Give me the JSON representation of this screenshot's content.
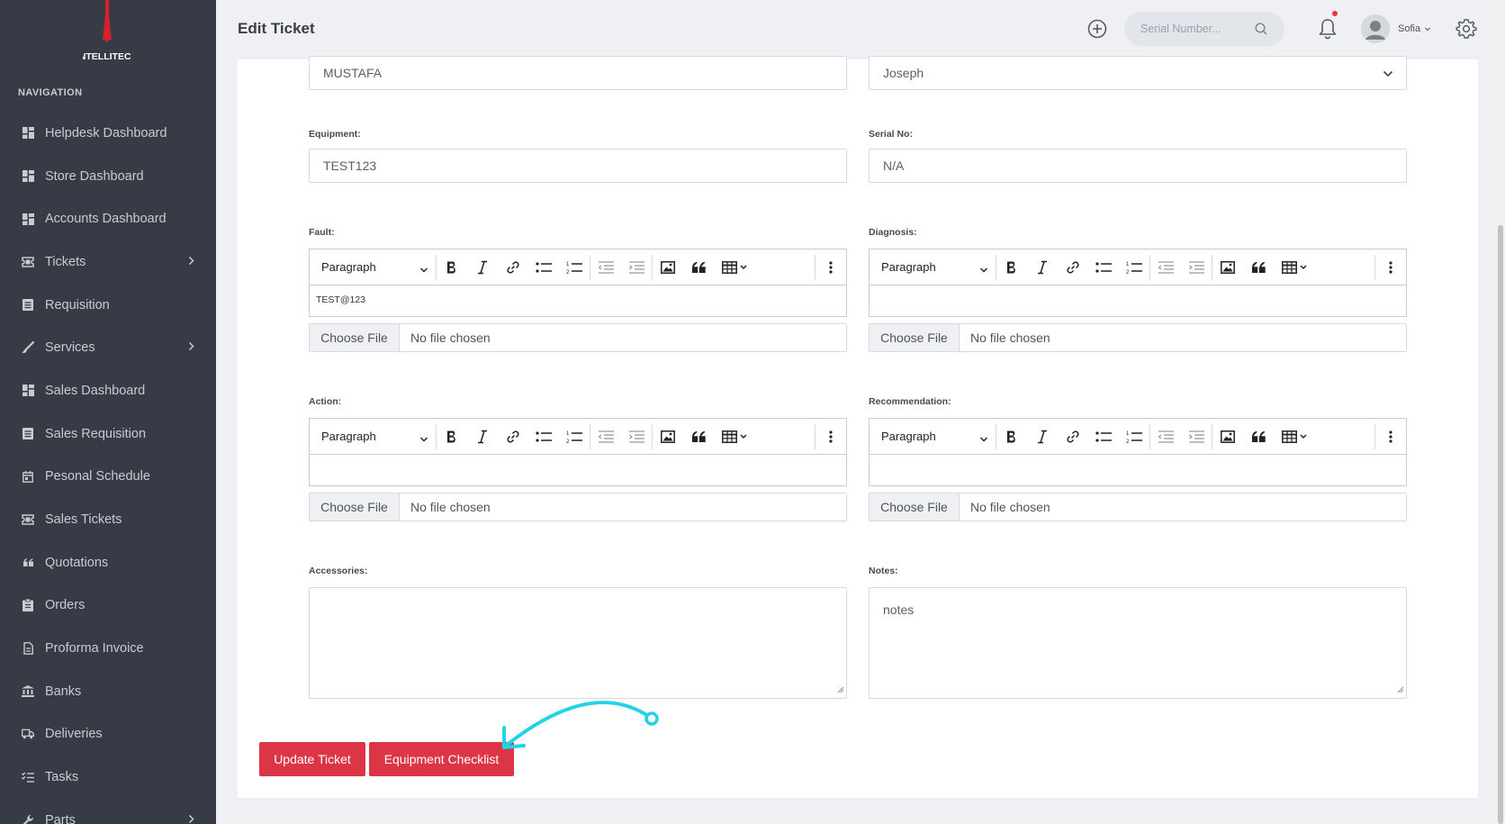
{
  "sidebar": {
    "logo_text": "INTELLITECH",
    "heading": "NAVIGATION",
    "items": [
      {
        "label": "Helpdesk Dashboard",
        "icon": "dashboard-icon"
      },
      {
        "label": "Store Dashboard",
        "icon": "dashboard-icon"
      },
      {
        "label": "Accounts Dashboard",
        "icon": "dashboard-icon"
      },
      {
        "label": "Tickets",
        "icon": "ticket-icon",
        "has_children": true
      },
      {
        "label": "Requisition",
        "icon": "list-icon"
      },
      {
        "label": "Services",
        "icon": "brush-icon",
        "has_children": true
      },
      {
        "label": "Sales Dashboard",
        "icon": "dashboard-icon"
      },
      {
        "label": "Sales Requisition",
        "icon": "list-icon"
      },
      {
        "label": "Pesonal Schedule",
        "icon": "calendar-icon"
      },
      {
        "label": "Sales Tickets",
        "icon": "ticket-icon"
      },
      {
        "label": "Quotations",
        "icon": "quote-icon"
      },
      {
        "label": "Orders",
        "icon": "clipboard-icon"
      },
      {
        "label": "Proforma Invoice",
        "icon": "file-icon"
      },
      {
        "label": "Banks",
        "icon": "bank-icon"
      },
      {
        "label": "Deliveries",
        "icon": "truck-icon"
      },
      {
        "label": "Tasks",
        "icon": "tasks-icon"
      },
      {
        "label": "Parts",
        "icon": "wrench-icon",
        "has_children": true
      }
    ]
  },
  "header": {
    "title": "Edit Ticket",
    "search_placeholder": "Serial Number...",
    "user_name": "Sofia"
  },
  "form": {
    "customer_value": "MUSTAFA",
    "technician_value": "Joseph",
    "equipment_label": "Equipment:",
    "equipment_value": "TEST123",
    "serial_label": "Serial No:",
    "serial_value": "N/A",
    "fault_label": "Fault:",
    "fault_content": "TEST@123",
    "diagnosis_label": "Diagnosis:",
    "diagnosis_content": "",
    "action_label": "Action:",
    "action_content": "",
    "recommendation_label": "Recommendation:",
    "recommendation_content": "",
    "accessories_label": "Accessories:",
    "accessories_value": "",
    "notes_label": "Notes:",
    "notes_value": "notes",
    "editor_style": "Paragraph",
    "file_button": "Choose File",
    "file_status": "No file chosen"
  },
  "buttons": {
    "update": "Update Ticket",
    "checklist": "Equipment Checklist"
  },
  "colors": {
    "sidebar_bg": "#363b45",
    "accent_red": "#dc3545",
    "annotation": "#22d3e6"
  }
}
